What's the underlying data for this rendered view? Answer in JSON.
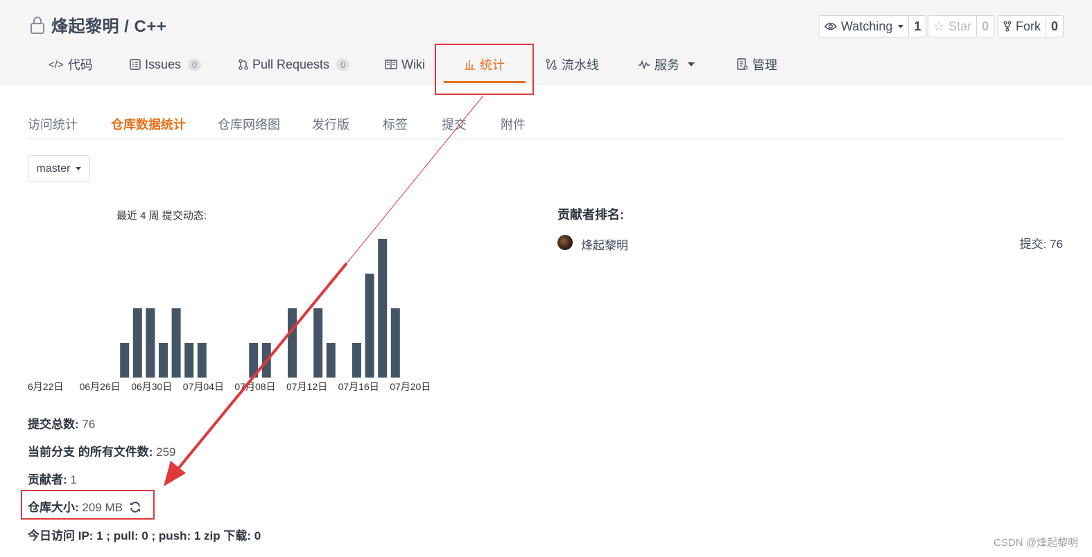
{
  "repo": {
    "owner_name": "烽起黎明",
    "separator": "/",
    "repo_name": "C++"
  },
  "actions": {
    "watch": {
      "label": "Watching",
      "count": "1"
    },
    "star": {
      "label": "Star",
      "count": "0"
    },
    "fork": {
      "label": "Fork",
      "count": "0"
    }
  },
  "tabs": [
    {
      "icon": "code-icon",
      "label": "代码"
    },
    {
      "icon": "issues-icon",
      "label": "Issues",
      "badge": "0"
    },
    {
      "icon": "pull-request-icon",
      "label": "Pull Requests",
      "badge": "0"
    },
    {
      "icon": "wiki-icon",
      "label": "Wiki"
    },
    {
      "icon": "bar-chart-icon",
      "label": "统计",
      "active": true
    },
    {
      "icon": "pipeline-icon",
      "label": "流水线"
    },
    {
      "icon": "pulse-icon",
      "label": "服务"
    },
    {
      "icon": "manage-icon",
      "label": "管理"
    }
  ],
  "subtabs": [
    "访问统计",
    "仓库数据统计",
    "仓库网络图",
    "发行版",
    "标签",
    "提交",
    "附件"
  ],
  "active_subtab": "仓库数据统计",
  "branch": {
    "label": "master"
  },
  "chart_title": "最近 4 周 提交动态:",
  "chart_data": {
    "type": "bar",
    "bar_color": "#445566",
    "x_tick_labels": [
      "6月22日",
      "06月26日",
      "06月30日",
      "07月04日",
      "07月08日",
      "07月12日",
      "07月16日",
      "07月20日"
    ],
    "values": [
      0,
      0,
      0,
      0,
      0,
      0,
      0,
      1,
      2,
      2,
      1,
      2,
      1,
      1,
      0,
      0,
      0,
      1,
      1,
      0,
      2,
      0,
      2,
      1,
      0,
      1,
      3,
      4,
      2
    ],
    "ylim": [
      0,
      4
    ]
  },
  "stats": {
    "commits_label": "提交总数:",
    "commits_value": "76",
    "files_label": "当前分支 的所有文件数:",
    "files_value": "259",
    "contributors_label": "贡献者:",
    "contributors_value": "1",
    "size_label": "仓库大小:",
    "size_value": "209 MB",
    "today_label": "今日访问 IP: 1 ; pull: 0 ; push: 1 zip 下载: 0"
  },
  "contributors": {
    "title": "贡献者排名:",
    "items": [
      {
        "name": "烽起黎明",
        "commits": "提交: 76"
      }
    ]
  },
  "watermark": "CSDN @烽起黎明",
  "colors": {
    "accent": "#e6711c",
    "annotation": "#e0383c",
    "bar": "#445566"
  }
}
